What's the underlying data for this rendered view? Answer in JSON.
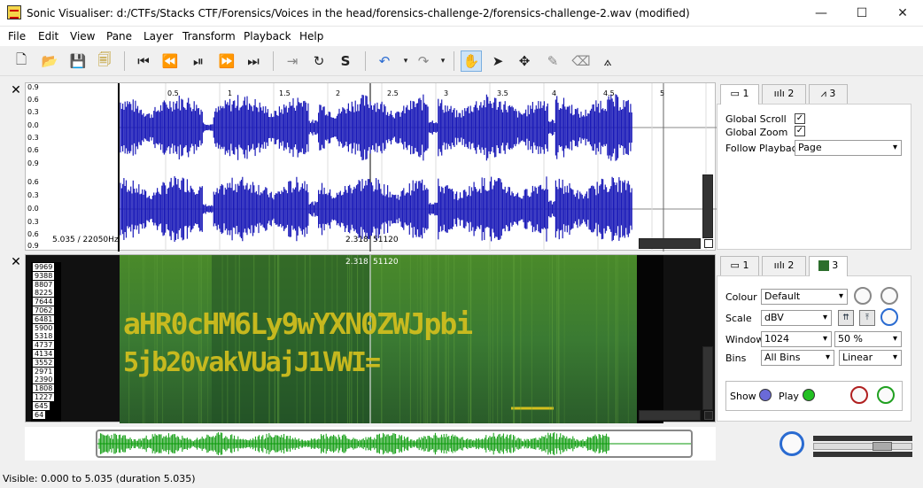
{
  "window": {
    "title": "Sonic Visualiser: d:/CTFs/Stacks CTF/Forensics/Voices in the head/forensics-challenge-2/forensics-challenge-2.wav (modified)",
    "minimize": "—",
    "maximize": "☐",
    "close": "✕"
  },
  "menu": [
    "File",
    "Edit",
    "View",
    "Pane",
    "Layer",
    "Transform",
    "Playback",
    "Help"
  ],
  "toolbar": {
    "icons": [
      "new-file-icon",
      "open-file-icon",
      "save-icon",
      "save-session-icon",
      "rewind-start-icon",
      "rewind-icon",
      "play-pause-icon",
      "fast-forward-icon",
      "fast-forward-end-icon",
      "constrain-playback-icon",
      "play-selection-icon",
      "solo-icon",
      "undo-icon",
      "redo-icon",
      "navigate-icon",
      "select-icon",
      "move-icon",
      "draw-icon",
      "erase-icon",
      "measure-icon"
    ]
  },
  "waveform_pane": {
    "ruler": [
      "0.5",
      "1",
      "1.5",
      "2",
      "2.5",
      "3",
      "3.5",
      "4",
      "4.5",
      "5"
    ],
    "y_labels": [
      "0.9",
      "0.6",
      "0.3",
      "0.0",
      "0.3",
      "0.6",
      "0.9",
      "0.6",
      "0.3",
      "0.0",
      "0.3",
      "0.6",
      "0.9"
    ],
    "info_left": "5.035 / 22050Hz",
    "cursor_time": "2.318",
    "cursor_frame": "51120"
  },
  "spectrogram_pane": {
    "freq_labels": [
      "9969",
      "9388",
      "8807",
      "8225",
      "7644",
      "7062",
      "6481",
      "5900",
      "5318",
      "4737",
      "4134",
      "3552",
      "2971",
      "2390",
      "1808",
      "1227",
      "645",
      "64"
    ],
    "cursor_time": "2.318",
    "cursor_frame": "51120",
    "hidden_text_line1": "aHR0cHM6Ly9wYXN0ZWJpbi",
    "hidden_text_line2": "5jb20vakVUajJ1VWI="
  },
  "props_top": {
    "tabs": [
      "1",
      "2",
      "3"
    ],
    "global_scroll": "Global Scroll",
    "global_zoom": "Global Zoom",
    "follow_playback_label": "Follow Playback",
    "follow_playback_value": "Page"
  },
  "props_bottom": {
    "tabs": [
      "1",
      "2",
      "3"
    ],
    "colour_label": "Colour",
    "colour_value": "Default",
    "scale_label": "Scale",
    "scale_value": "dBV",
    "window_label": "Window",
    "window_value": "1024",
    "window_overlap": "50 %",
    "bins_label": "Bins",
    "bins_value": "All Bins",
    "bins_scale": "Linear",
    "show_label": "Show",
    "play_label": "Play"
  },
  "status": "Visible: 0.000 to 5.035 (duration 5.035)",
  "colors": {
    "waveform": "#1a1ab8",
    "overview_wave": "#0a9a0a",
    "spectrogram_bg": "#2e6b2e",
    "spectrogram_text": "#d4c01e"
  }
}
